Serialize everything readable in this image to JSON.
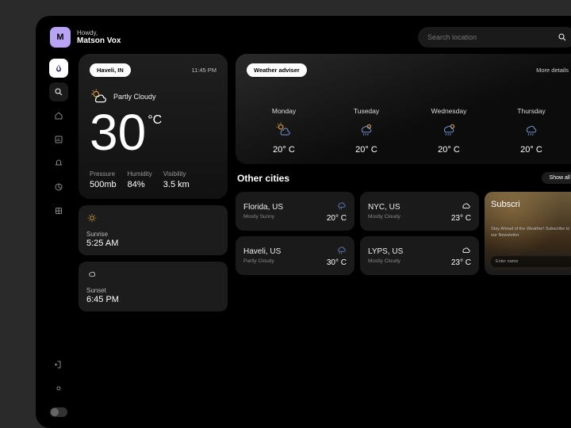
{
  "user": {
    "greeting": "Howdy,",
    "name": "Matson Vox",
    "initial": "M"
  },
  "search": {
    "placeholder": "Search location"
  },
  "current": {
    "location": "Haveli, IN",
    "time": "11:45 PM",
    "condition": "Partly Cloudy",
    "temp": "30",
    "unit": "°C",
    "metrics": {
      "pressure_label": "Pressure",
      "pressure": "500mb",
      "humidity_label": "Humidity",
      "humidity": "84%",
      "visibility_label": "Visibility",
      "visibility": "3.5 km"
    },
    "sunrise": {
      "label": "Sunrise",
      "time": "5:25 AM"
    },
    "sunset": {
      "label": "Sunset",
      "time": "6:45 PM"
    }
  },
  "adviser": {
    "chip": "Weather adviser",
    "more": "More details",
    "days": [
      {
        "name": "Monday",
        "icon": "partly",
        "temp": "20° C"
      },
      {
        "name": "Tuseday",
        "icon": "rain",
        "temp": "20° C"
      },
      {
        "name": "Wednesday",
        "icon": "rain2",
        "temp": "20° C"
      },
      {
        "name": "Thursday",
        "icon": "rain",
        "temp": "20° C"
      }
    ]
  },
  "other": {
    "title": "Other cities",
    "show_all": "Show all",
    "cities": [
      {
        "name": "Florida, US",
        "cond": "Mostly Sunny",
        "temp": "20° C",
        "icon": "rain"
      },
      {
        "name": "NYC, US",
        "cond": "Mostly Cloudy",
        "temp": "23° C",
        "icon": "cloud"
      },
      {
        "name": "Haveli, US",
        "cond": "Partly Cloudy",
        "temp": "30° C",
        "icon": "rain"
      },
      {
        "name": "LYPS, US",
        "cond": "Mostly Cloudy",
        "temp": "23° C",
        "icon": "cloud"
      }
    ]
  },
  "promo": {
    "title": "Subscri",
    "text": "Stay Ahead of the Weather! Subscribe to our Newsletter",
    "placeholder": "Enter name"
  }
}
